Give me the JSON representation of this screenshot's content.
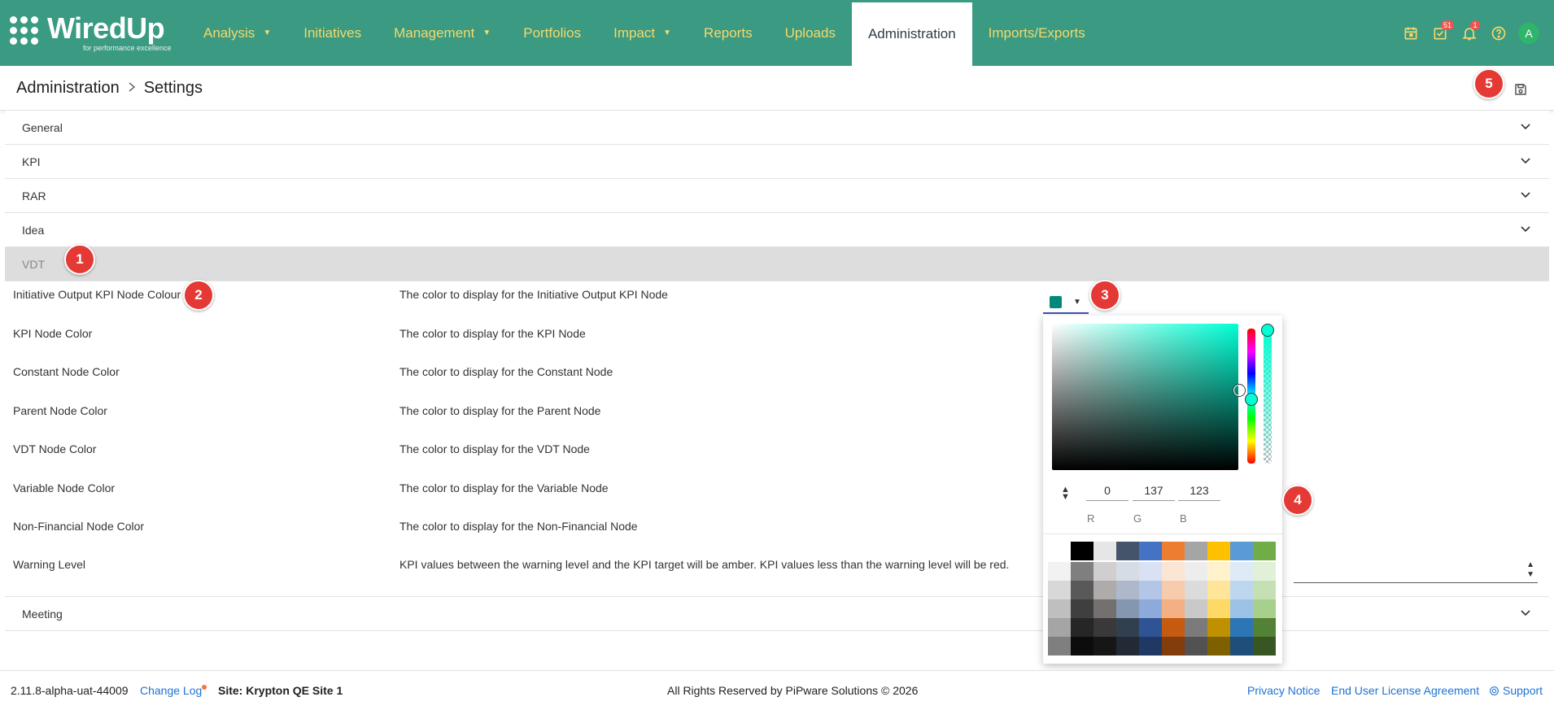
{
  "brand": {
    "name": "WiredUp",
    "tagline": "for performance excellence"
  },
  "nav": {
    "items": [
      {
        "label": "Analysis",
        "has_caret": true
      },
      {
        "label": "Initiatives",
        "has_caret": false
      },
      {
        "label": "Management",
        "has_caret": true
      },
      {
        "label": "Portfolios",
        "has_caret": false
      },
      {
        "label": "Impact",
        "has_caret": true
      },
      {
        "label": "Reports",
        "has_caret": false
      },
      {
        "label": "Uploads",
        "has_caret": false
      },
      {
        "label": "Administration",
        "has_caret": false,
        "active": true
      },
      {
        "label": "Imports/Exports",
        "has_caret": false
      }
    ]
  },
  "header_icons": {
    "tasks_badge": "51",
    "notifications_badge": "1",
    "avatar_initial": "A"
  },
  "breadcrumb": {
    "root": "Administration",
    "current": "Settings"
  },
  "accordion": {
    "general": "General",
    "kpi": "KPI",
    "rar": "RAR",
    "idea": "Idea",
    "vdt": "VDT",
    "meeting": "Meeting"
  },
  "settings": [
    {
      "name": "Initiative Output KPI Node Colour",
      "description": "The color to display for the Initiative Output KPI Node"
    },
    {
      "name": "KPI Node Color",
      "description": "The color to display for the KPI Node"
    },
    {
      "name": "Constant Node Color",
      "description": "The color to display for the Constant Node"
    },
    {
      "name": "Parent Node Color",
      "description": "The color to display for the Parent Node"
    },
    {
      "name": "VDT Node Color",
      "description": "The color to display for the VDT Node"
    },
    {
      "name": "Variable Node Color",
      "description": "The color to display for the Variable Node"
    },
    {
      "name": "Non-Financial Node Color",
      "description": "The color to display for the Non-Financial Node"
    },
    {
      "name": "Warning Level",
      "description": "KPI values between the warning level and the KPI target will be amber. KPI values less than the warning level will be red."
    }
  ],
  "color_picker": {
    "selected_color": "#00897b",
    "r": "0",
    "g": "137",
    "b": "123",
    "r_label": "R",
    "g_label": "G",
    "b_label": "B",
    "palette_top": [
      "#ffffff",
      "#000000",
      "#e7e6e6",
      "#44546a",
      "#4472c4",
      "#ed7d31",
      "#a5a5a5",
      "#ffc000",
      "#5b9bd5",
      "#70ad47"
    ],
    "palette_rows": [
      [
        "#f2f2f2",
        "#7f7f7f",
        "#d0cece",
        "#d6dce4",
        "#d9e2f3",
        "#fbe5d5",
        "#ededed",
        "#fff2cc",
        "#deebf6",
        "#e2efd9"
      ],
      [
        "#d8d8d8",
        "#595959",
        "#aeabab",
        "#adb9ca",
        "#b4c6e7",
        "#f7cbac",
        "#dbdbdb",
        "#fee599",
        "#bdd7ee",
        "#c5e0b3"
      ],
      [
        "#bfbfbf",
        "#3f3f3f",
        "#757070",
        "#8496b0",
        "#8eaadb",
        "#f4b083",
        "#c9c9c9",
        "#ffd965",
        "#9cc3e5",
        "#a8d08d"
      ],
      [
        "#a5a5a5",
        "#262626",
        "#3a3838",
        "#323f4f",
        "#2f5496",
        "#c55a11",
        "#7b7b7b",
        "#bf9000",
        "#2e75b5",
        "#538135"
      ],
      [
        "#7f7f7f",
        "#0c0c0c",
        "#171616",
        "#222a35",
        "#1f3864",
        "#833c0b",
        "#525252",
        "#7f6000",
        "#1e4e79",
        "#375623"
      ]
    ]
  },
  "markers": [
    "1",
    "2",
    "3",
    "4",
    "5"
  ],
  "footer": {
    "version": "2.11.8-alpha-uat-44009",
    "changelog": "Change Log",
    "site": "Site: Krypton QE Site 1",
    "rights": "All Rights Reserved by PiPware Solutions © 2026",
    "privacy": "Privacy Notice",
    "eula": "End User License Agreement",
    "support": "Support"
  }
}
